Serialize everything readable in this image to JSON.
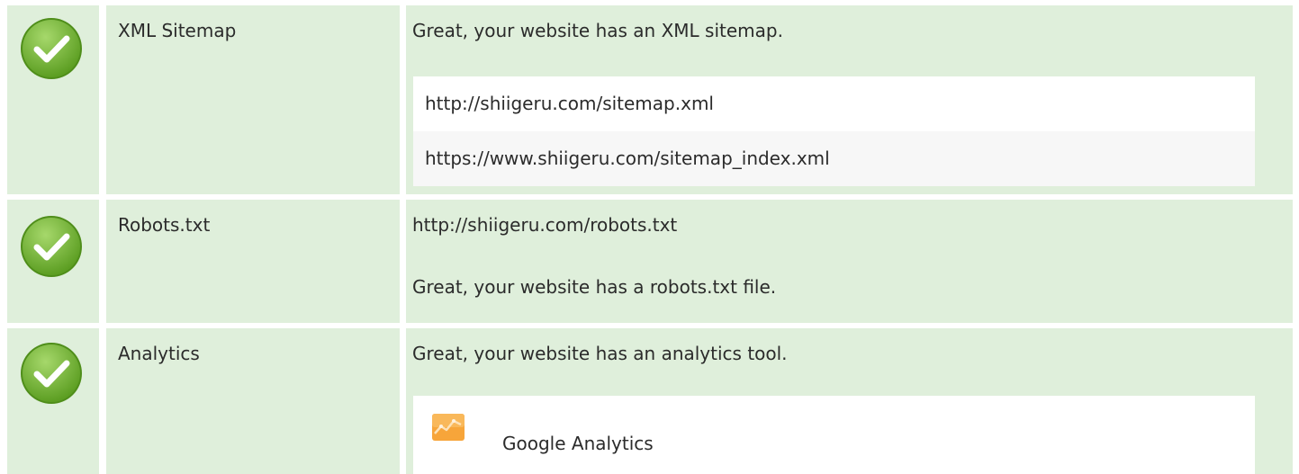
{
  "colors": {
    "row_background": "#dfefdb",
    "check_green": "#6cae2c",
    "ga_orange": "#f7a53a"
  },
  "rows": [
    {
      "icon": "check-icon",
      "name": "XML Sitemap",
      "message": "Great, your website has an XML sitemap.",
      "entries": [
        "http://shiigeru.com/sitemap.xml",
        "https://www.shiigeru.com/sitemap_index.xml"
      ]
    },
    {
      "icon": "check-icon",
      "name": "Robots.txt",
      "url": "http://shiigeru.com/robots.txt",
      "message": "Great, your website has a robots.txt file."
    },
    {
      "icon": "check-icon",
      "name": "Analytics",
      "message": "Great, your website has an analytics tool.",
      "tools": [
        {
          "icon": "google-analytics-icon",
          "label": "Google Analytics"
        }
      ]
    }
  ]
}
